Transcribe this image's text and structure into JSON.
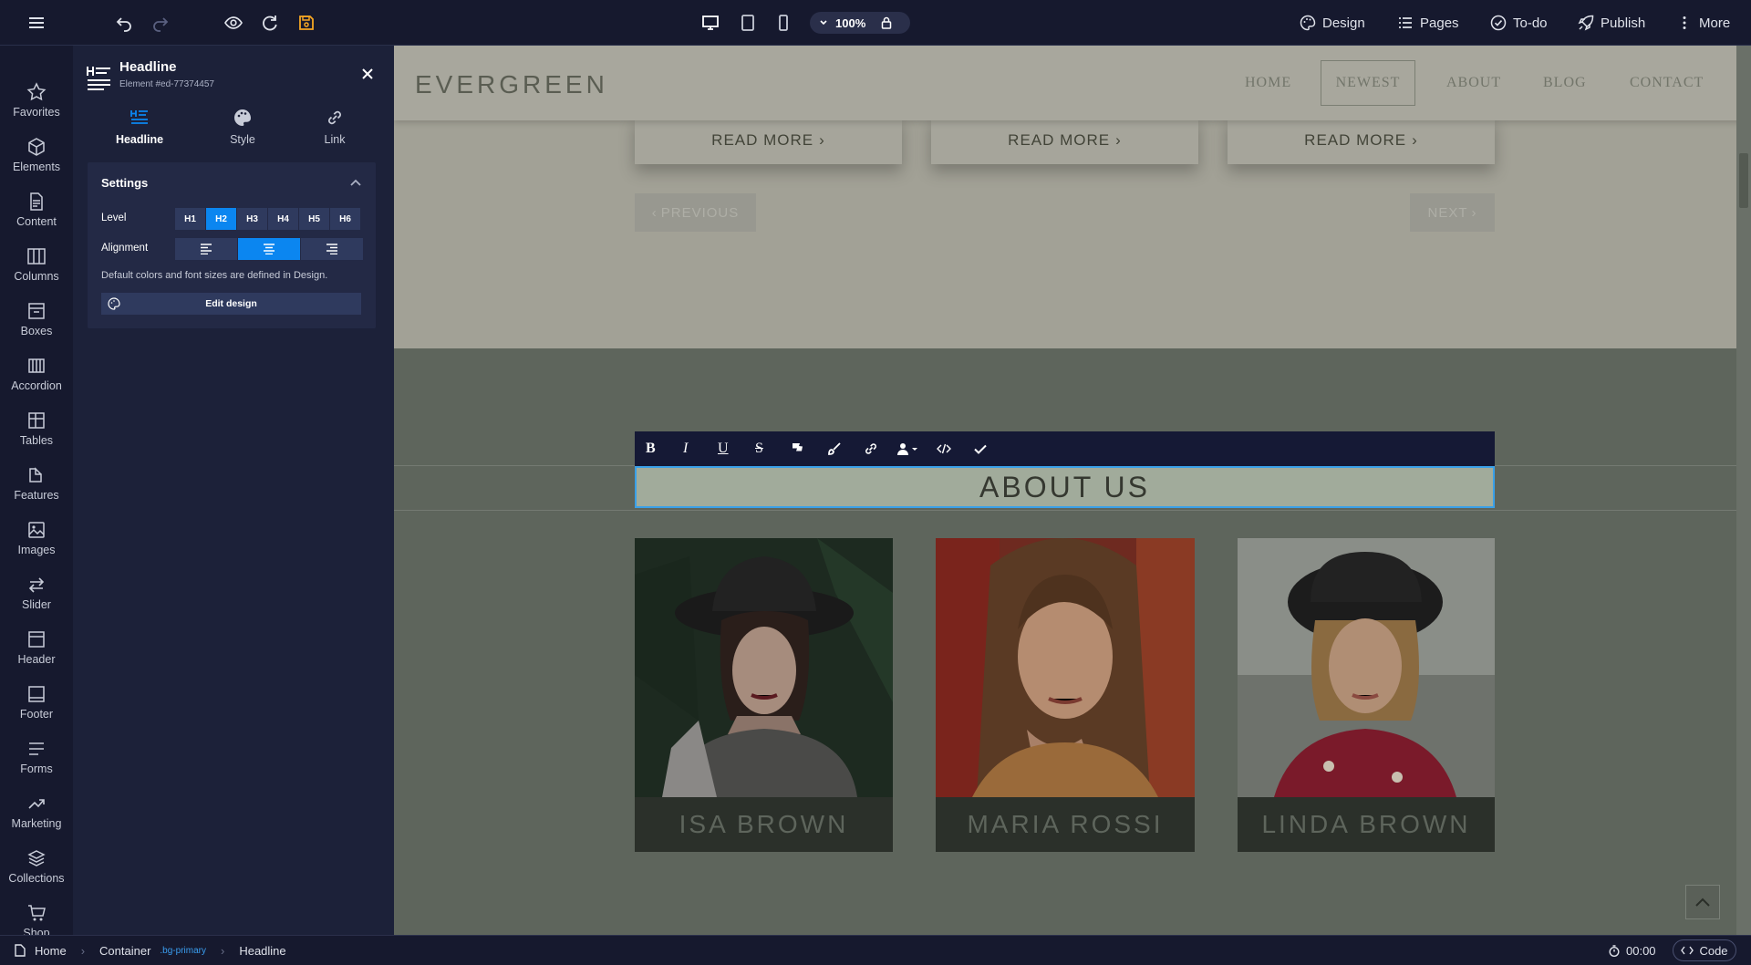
{
  "top": {
    "zoom": "100%",
    "menu": {
      "design": "Design",
      "pages": "Pages",
      "todo": "To-do",
      "publish": "Publish",
      "more": "More"
    }
  },
  "sidebar": {
    "items": [
      "Favorites",
      "Elements",
      "Content",
      "Columns",
      "Boxes",
      "Accordion",
      "Tables",
      "Features",
      "Images",
      "Slider",
      "Header",
      "Footer",
      "Forms",
      "Marketing",
      "Collections",
      "Shop"
    ]
  },
  "panel": {
    "title": "Headline",
    "element_id": "Element #ed-77374457",
    "tabs": [
      "Headline",
      "Style",
      "Link"
    ],
    "settings_title": "Settings",
    "level_label": "Level",
    "levels": [
      "H1",
      "H2",
      "H3",
      "H4",
      "H5",
      "H6"
    ],
    "active_level": "H2",
    "alignment_label": "Alignment",
    "active_alignment": "center",
    "note": "Default colors and font sizes are defined in Design.",
    "edit_design": "Edit design"
  },
  "site": {
    "logo": "EVERGREEN",
    "nav": [
      "HOME",
      "NEWEST",
      "ABOUT",
      "BLOG",
      "CONTACT"
    ],
    "active_nav": "NEWEST",
    "read_more": "READ MORE",
    "previous": "PREVIOUS",
    "next": "NEXT",
    "about_heading": "ABOUT US",
    "team": [
      "ISA BROWN",
      "MARIA ROSSI",
      "LINDA BROWN"
    ]
  },
  "status": {
    "crumbs": [
      "Home",
      "Container",
      ".bg-primary",
      "Headline"
    ],
    "timer": "00:00",
    "code": "Code"
  },
  "colors": {
    "accent": "#0b86f0",
    "editor_bg": "#16192e",
    "save_icon": "#f5a623"
  }
}
